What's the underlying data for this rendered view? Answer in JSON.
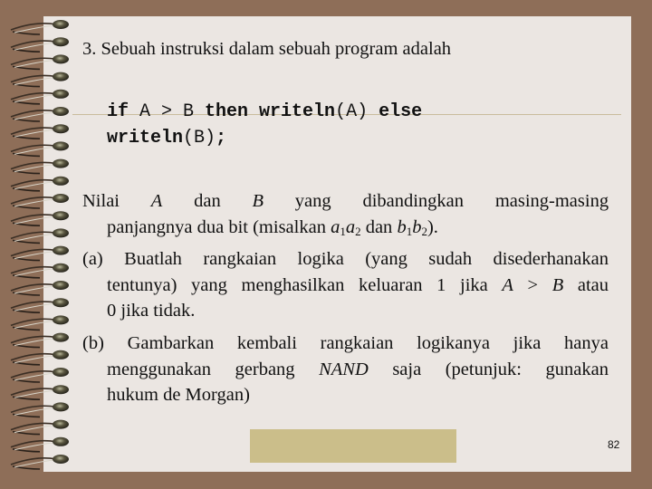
{
  "slide": {
    "title": "3. Sebuah instruksi dalam sebuah program adalah",
    "code": {
      "line1": [
        {
          "text": "if",
          "bold": true
        },
        {
          "text": " A > B ",
          "bold": false
        },
        {
          "text": "then writeln",
          "bold": true
        },
        {
          "text": "(A)",
          "bold": false
        },
        {
          "text": " else",
          "bold": true
        }
      ],
      "line2": [
        {
          "text": "writeln",
          "bold": true
        },
        {
          "text": "(B)",
          "bold": false
        },
        {
          "text": ";",
          "bold": true
        }
      ]
    },
    "intro": {
      "w1": "Nilai",
      "A": "A",
      "w2": "dan",
      "B": "B",
      "w3": "yang",
      "w4": "dibandingkan",
      "w5": "masing-masing",
      "line2_pre": "panjangnya dua bit (misalkan ",
      "a": "a",
      "sub1": "1",
      "sub2": "2",
      "mid": " dan ",
      "b": "b",
      "end": ")."
    },
    "part_a": {
      "label": "(a)",
      "line1": "Buatlah rangkaian logika (yang sudah disederhanakan",
      "line2_pre": "tentunya)  yang menghasilkan keluaran 1 jika ",
      "A": "A",
      "gt": " > ",
      "B": "B",
      "line2_post": " atau",
      "line3": "0 jika tidak."
    },
    "part_b": {
      "label": "(b)",
      "line1": "Gambarkan kembali rangkaian logikanya jika hanya",
      "line2_pre": "menggunakan gerbang ",
      "nand": "NAND",
      "line2_post": " saja (petunjuk: gunakan",
      "line3": "hukum de Morgan)"
    },
    "page_number": "82"
  },
  "colors": {
    "background": "#8e6e58",
    "page": "#ebe6e2",
    "accent_box": "#cbbe8a",
    "rule": "#c9bc9c"
  }
}
